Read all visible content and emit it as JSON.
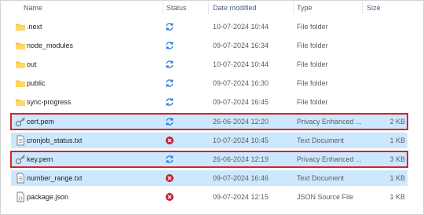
{
  "columns": {
    "name": "Name",
    "status": "Status",
    "date_modified": "Date modified",
    "type": "Type",
    "size": "Size"
  },
  "colors": {
    "selection": "#cce8ff",
    "highlight_outline": "#d9222a",
    "sync_icon": "#2a79d7",
    "error_icon": "#c81e32",
    "folder": "#f5c344"
  },
  "files": [
    {
      "name": ".next",
      "icon": "folder-icon",
      "status": "sync-icon",
      "date": "10-07-2024 10:44",
      "type": "File folder",
      "size": ""
    },
    {
      "name": "node_modules",
      "icon": "folder-icon",
      "status": "sync-icon",
      "date": "09-07-2024 16:34",
      "type": "File folder",
      "size": ""
    },
    {
      "name": "out",
      "icon": "folder-icon",
      "status": "sync-icon",
      "date": "10-07-2024 10:44",
      "type": "File folder",
      "size": ""
    },
    {
      "name": "public",
      "icon": "folder-icon",
      "status": "sync-icon",
      "date": "09-07-2024 16:30",
      "type": "File folder",
      "size": ""
    },
    {
      "name": "sync-progress",
      "icon": "folder-icon",
      "status": "sync-icon",
      "date": "09-07-2024 16:45",
      "type": "File folder",
      "size": ""
    },
    {
      "name": "cert.pem",
      "icon": "certificate-file-icon",
      "status": "sync-icon",
      "date": "26-06-2024 12:20",
      "type": "Privacy Enhanced ...",
      "size": "2 KB"
    },
    {
      "name": "cronjob_status.txt",
      "icon": "text-file-icon",
      "status": "error-icon",
      "date": "10-07-2024 10:45",
      "type": "Text Document",
      "size": "1 KB"
    },
    {
      "name": "key.pem",
      "icon": "certificate-file-icon",
      "status": "sync-icon",
      "date": "26-06-2024 12:19",
      "type": "Privacy Enhanced ...",
      "size": "3 KB"
    },
    {
      "name": "number_range.txt",
      "icon": "text-file-icon",
      "status": "error-icon",
      "date": "09-07-2024 16:46",
      "type": "Text Document",
      "size": "1 KB"
    },
    {
      "name": "package.json",
      "icon": "json-file-icon",
      "status": "error-icon",
      "date": "09-07-2024 12:15",
      "type": "JSON Source File",
      "size": "1 KB"
    }
  ]
}
